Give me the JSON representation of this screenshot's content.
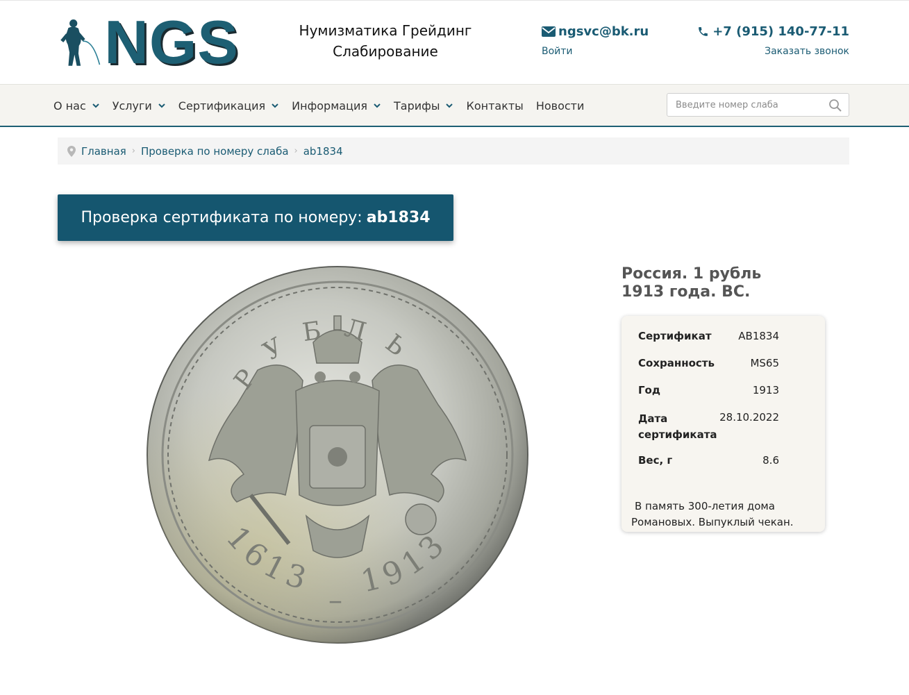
{
  "header": {
    "logo_text": "NGS",
    "tagline_line1": "Нумизматика Грейдинг",
    "tagline_line2": "Слабирование",
    "email": "ngsvc@bk.ru",
    "login": "Войти",
    "phone": "+7 (915) 140-77-11",
    "callback": "Заказать звонок",
    "brand_color": "#1d5f73"
  },
  "nav": {
    "items": [
      {
        "label": "О нас",
        "dropdown": true
      },
      {
        "label": "Услуги",
        "dropdown": true
      },
      {
        "label": "Сертификация",
        "dropdown": true
      },
      {
        "label": "Информация",
        "dropdown": true
      },
      {
        "label": "Тарифы",
        "dropdown": true
      },
      {
        "label": "Контакты",
        "dropdown": false
      },
      {
        "label": "Новости",
        "dropdown": false
      }
    ],
    "search_placeholder": "Введите номер слаба"
  },
  "breadcrumb": {
    "items": [
      "Главная",
      "Проверка по номеру слаба",
      "ab1834"
    ]
  },
  "banner": {
    "prefix": "Проверка сертификата по номеру:",
    "number": "ab1834"
  },
  "coin": {
    "top_legend": "РУБЛЬ",
    "bottom_left_year": "1613",
    "bottom_right_year": "1913",
    "bottom_separator": "–"
  },
  "product": {
    "title": "Россия. 1 рубль 1913 года. ВС.",
    "details": [
      {
        "key": "Сертификат",
        "value": "AB1834"
      },
      {
        "key": "Сохранность",
        "value": "MS65"
      },
      {
        "key": "Год",
        "value": "1913"
      },
      {
        "key": "Дата сертификата",
        "value": "28.10.2022"
      },
      {
        "key": "Вес, г",
        "value": "8.6"
      }
    ],
    "description": "В память 300-летия дома Романовых. Выпуклый чекан."
  }
}
